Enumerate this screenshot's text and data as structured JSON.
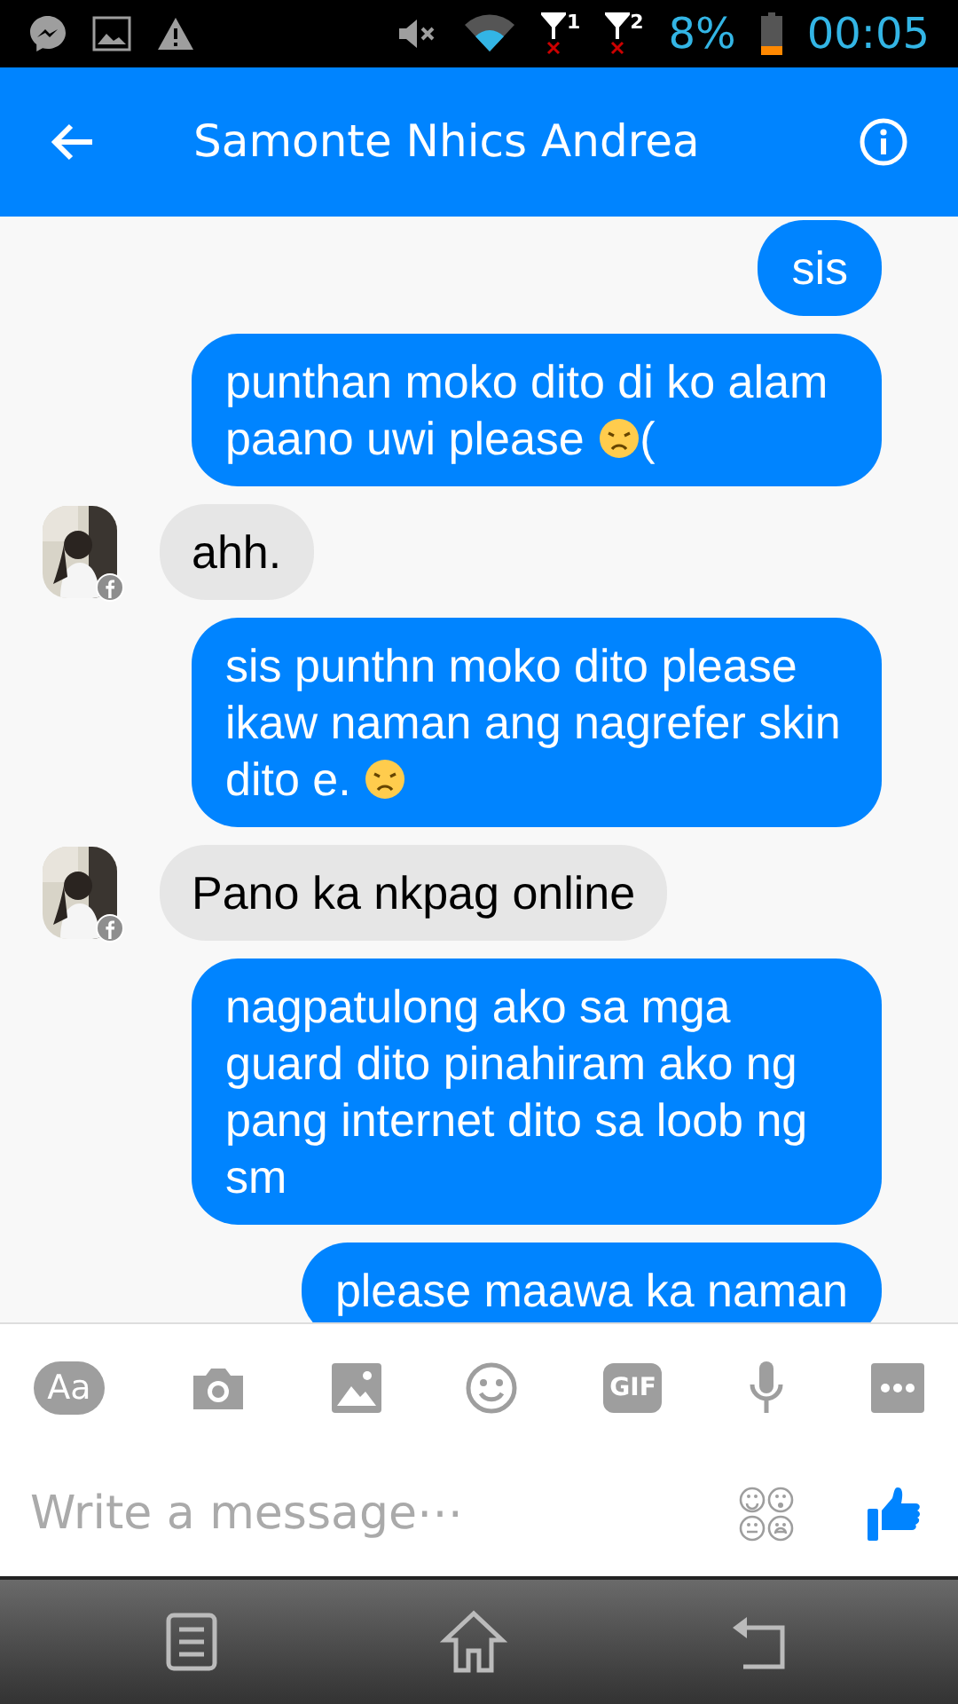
{
  "status_bar": {
    "sim_1": "1",
    "sim_2": "2",
    "battery": "8%",
    "time": "00:05"
  },
  "header": {
    "title": "Samonte Nhics Andrea"
  },
  "messages": [
    {
      "kind": "sent",
      "parts": [
        {
          "kind": "text",
          "text": "sis"
        }
      ]
    },
    {
      "kind": "sent",
      "parts": [
        {
          "kind": "text",
          "text": "punthan moko dito di ko alam paano uwi please "
        },
        {
          "kind": "sad-face"
        },
        {
          "kind": "text",
          "text": "("
        }
      ]
    },
    {
      "kind": "received",
      "parts": [
        {
          "kind": "text",
          "text": "ahh."
        }
      ]
    },
    {
      "kind": "sent",
      "parts": [
        {
          "kind": "text",
          "text": "sis punthn moko dito please ikaw naman ang nagrefer skin dito e. "
        },
        {
          "kind": "sad-face"
        }
      ]
    },
    {
      "kind": "received",
      "parts": [
        {
          "kind": "text",
          "text": "Pano ka nkpag online"
        }
      ]
    },
    {
      "kind": "sent",
      "parts": [
        {
          "kind": "text",
          "text": "nagpatulong ako sa mga guard dito pinahiram ako ng pang internet dito sa loob ng sm"
        }
      ]
    },
    {
      "kind": "sent",
      "parts": [
        {
          "kind": "text",
          "text": "please maawa ka naman"
        }
      ]
    }
  ],
  "composer": {
    "font_button": "Aa",
    "gif_button": "GIF",
    "placeholder": "Write a message⋯"
  }
}
